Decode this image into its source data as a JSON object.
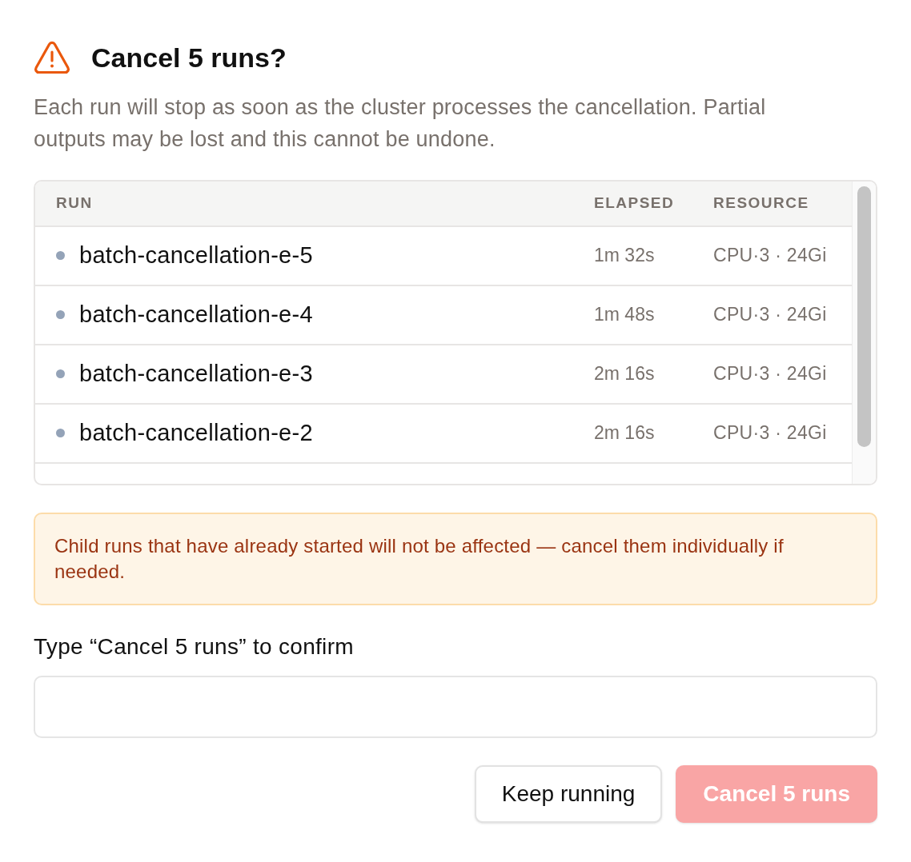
{
  "dialog": {
    "title": "Cancel 5 runs?",
    "description": "Each run will stop as soon as the cluster processes the cancellation. Partial outputs may be lost and this cannot be undone."
  },
  "table": {
    "columns": [
      "RUN",
      "ELAPSED",
      "RESOURCE"
    ],
    "rows": [
      {
        "run": "batch-cancellation-e-5",
        "color": "#94a3b8",
        "elapsed": "1m 32s",
        "resource": "CPU·3 · 24Gi"
      },
      {
        "run": "batch-cancellation-e-4",
        "color": "#94a3b8",
        "elapsed": "1m 48s",
        "resource": "CPU·3 · 24Gi"
      },
      {
        "run": "batch-cancellation-e-3",
        "color": "#94a3b8",
        "elapsed": "2m 16s",
        "resource": "CPU·3 · 24Gi"
      },
      {
        "run": "batch-cancellation-e-2",
        "color": "#94a3b8",
        "elapsed": "2m 16s",
        "resource": "CPU·3 · 24Gi"
      }
    ]
  },
  "notice": {
    "text": "Child runs that have already started will not be affected — cancel them individually if needed."
  },
  "confirm": {
    "label": "Type “Cancel 5 runs” to confirm"
  },
  "buttons": [
    {
      "label": "Keep running",
      "kind": "secondary",
      "disabled": false
    },
    {
      "label": "Cancel 5 runs",
      "kind": "danger",
      "disabled": true
    }
  ]
}
